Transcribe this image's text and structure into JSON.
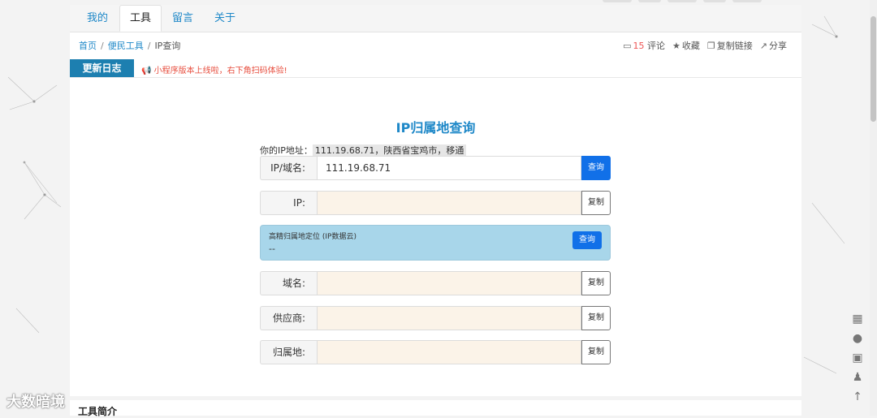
{
  "tabs": [
    {
      "label": "我的"
    },
    {
      "label": "工具"
    },
    {
      "label": "留言"
    },
    {
      "label": "关于"
    }
  ],
  "breadcrumb": {
    "home": "首页",
    "category": "便民工具",
    "current": "IP查询",
    "sep": "/"
  },
  "actions": {
    "comment_count": "15",
    "comment_label": "评论",
    "favorite": "收藏",
    "copy_link": "复制链接",
    "share": "分享"
  },
  "changelog": {
    "badge": "更新日志",
    "notice": "小程序版本上线啦，右下角扫码体验!"
  },
  "tool": {
    "title": "IP归属地查询",
    "my_ip_label": "你的IP地址：",
    "my_ip_value": "111.19.68.71，陕西省宝鸡市，移通",
    "query_row": {
      "label": "IP/域名:",
      "value": "111.19.68.71",
      "button": "查询"
    },
    "ip_row": {
      "label": "IP:",
      "value": "",
      "button": "复制"
    },
    "geo": {
      "title": "高精归属地定位 (IP数据云)",
      "value": "--",
      "button": "查询"
    },
    "domain_row": {
      "label": "域名:",
      "value": "",
      "button": "复制"
    },
    "provider_row": {
      "label": "供应商:",
      "value": "",
      "button": "复制"
    },
    "location_row": {
      "label": "归属地:",
      "value": "",
      "button": "复制"
    }
  },
  "section2": {
    "heading": "工具简介"
  },
  "watermark": "大数暗境",
  "colors": {
    "accent": "#1e88c8",
    "button": "#1170e8",
    "badge": "#1d7fb0",
    "notice": "#e74c3c",
    "field_bg": "#fbf3e8",
    "geo_bg": "#a8d6ea"
  },
  "icons": [
    "comment-icon",
    "star-icon",
    "copy-icon",
    "share-icon",
    "megaphone-icon",
    "qrcode-icon",
    "wechat-icon",
    "gift-icon",
    "qq-icon",
    "arrow-up-icon"
  ]
}
